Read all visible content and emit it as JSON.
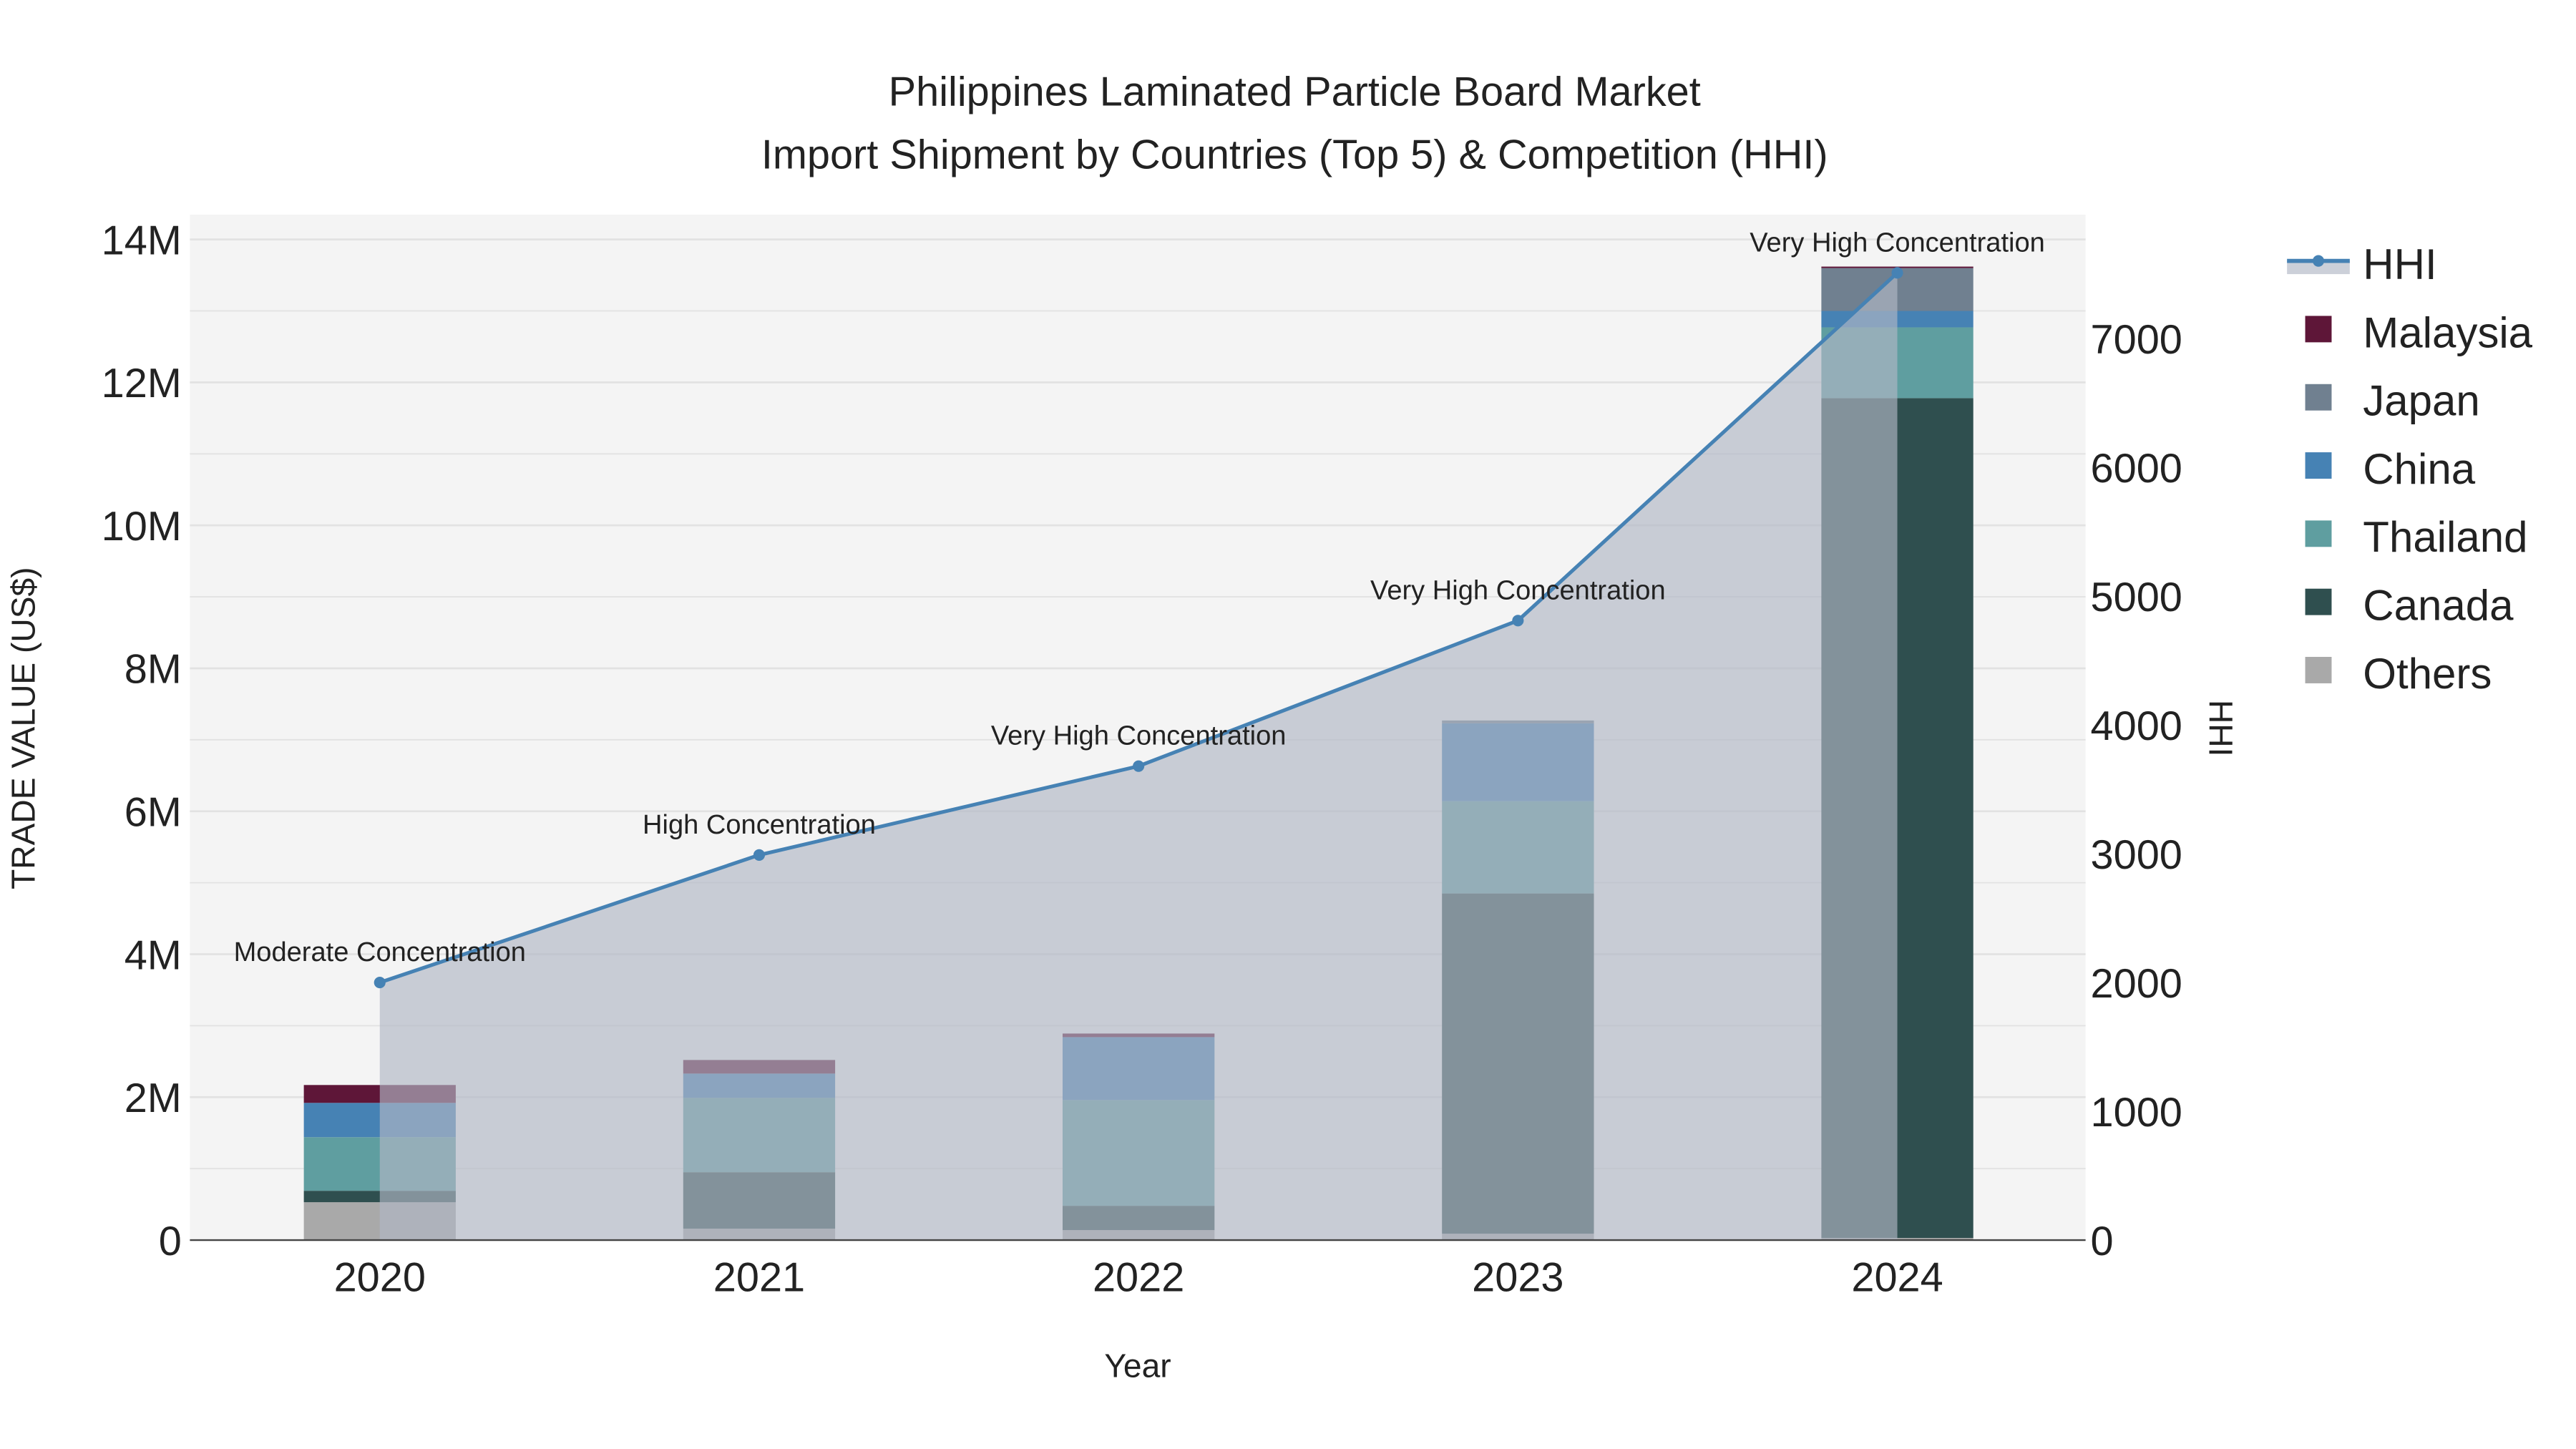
{
  "chart_data": {
    "type": "bar",
    "title": "Philippines Laminated Particle Board Market",
    "subtitle": "Import Shipment by Countries (Top 5) & Competition (HHI)",
    "xlabel": "Year",
    "ylabel": "TRADE VALUE (US$)",
    "y2label": "HHI",
    "categories": [
      "2020",
      "2021",
      "2022",
      "2023",
      "2024"
    ],
    "ylim": [
      0,
      14000000
    ],
    "y2lim": [
      0,
      7800
    ],
    "yticks": [
      0,
      2000000,
      4000000,
      6000000,
      8000000,
      10000000,
      12000000,
      14000000
    ],
    "ytick_labels": [
      "0",
      "2M",
      "4M",
      "6M",
      "8M",
      "10M",
      "12M",
      "14M"
    ],
    "y2ticks": [
      0,
      1000,
      2000,
      3000,
      4000,
      5000,
      6000,
      7000
    ],
    "y2tick_labels": [
      "0",
      "1000",
      "2000",
      "3000",
      "4000",
      "5000",
      "6000",
      "7000"
    ],
    "stacked": true,
    "grid": true,
    "legend_position": "right",
    "series": [
      {
        "name": "Others",
        "color": "#a9a9a9",
        "values": [
          530000,
          160000,
          140000,
          90000,
          30000
        ]
      },
      {
        "name": "Canada",
        "color": "#2f4f4f",
        "values": [
          160000,
          790000,
          340000,
          4760000,
          11750000
        ]
      },
      {
        "name": "Thailand",
        "color": "#5f9ea0",
        "values": [
          750000,
          1040000,
          1480000,
          1290000,
          990000
        ]
      },
      {
        "name": "China",
        "color": "#4682b4",
        "values": [
          480000,
          340000,
          880000,
          1090000,
          230000
        ]
      },
      {
        "name": "Japan",
        "color": "#708090",
        "values": [
          0,
          0,
          0,
          40000,
          600000
        ]
      },
      {
        "name": "Malaysia",
        "color": "#5e1638",
        "values": [
          250000,
          190000,
          50000,
          0,
          20000
        ]
      }
    ],
    "hhi": {
      "name": "HHI",
      "color": "#4682b4",
      "values": [
        2000,
        2990,
        3680,
        4810,
        7510
      ],
      "annotations": [
        "Moderate Concentration",
        "High Concentration",
        "Very High Concentration",
        "Very High Concentration",
        "Very High Concentration"
      ]
    },
    "legend_order": [
      "HHI",
      "Malaysia",
      "Japan",
      "China",
      "Thailand",
      "Canada",
      "Others"
    ]
  }
}
